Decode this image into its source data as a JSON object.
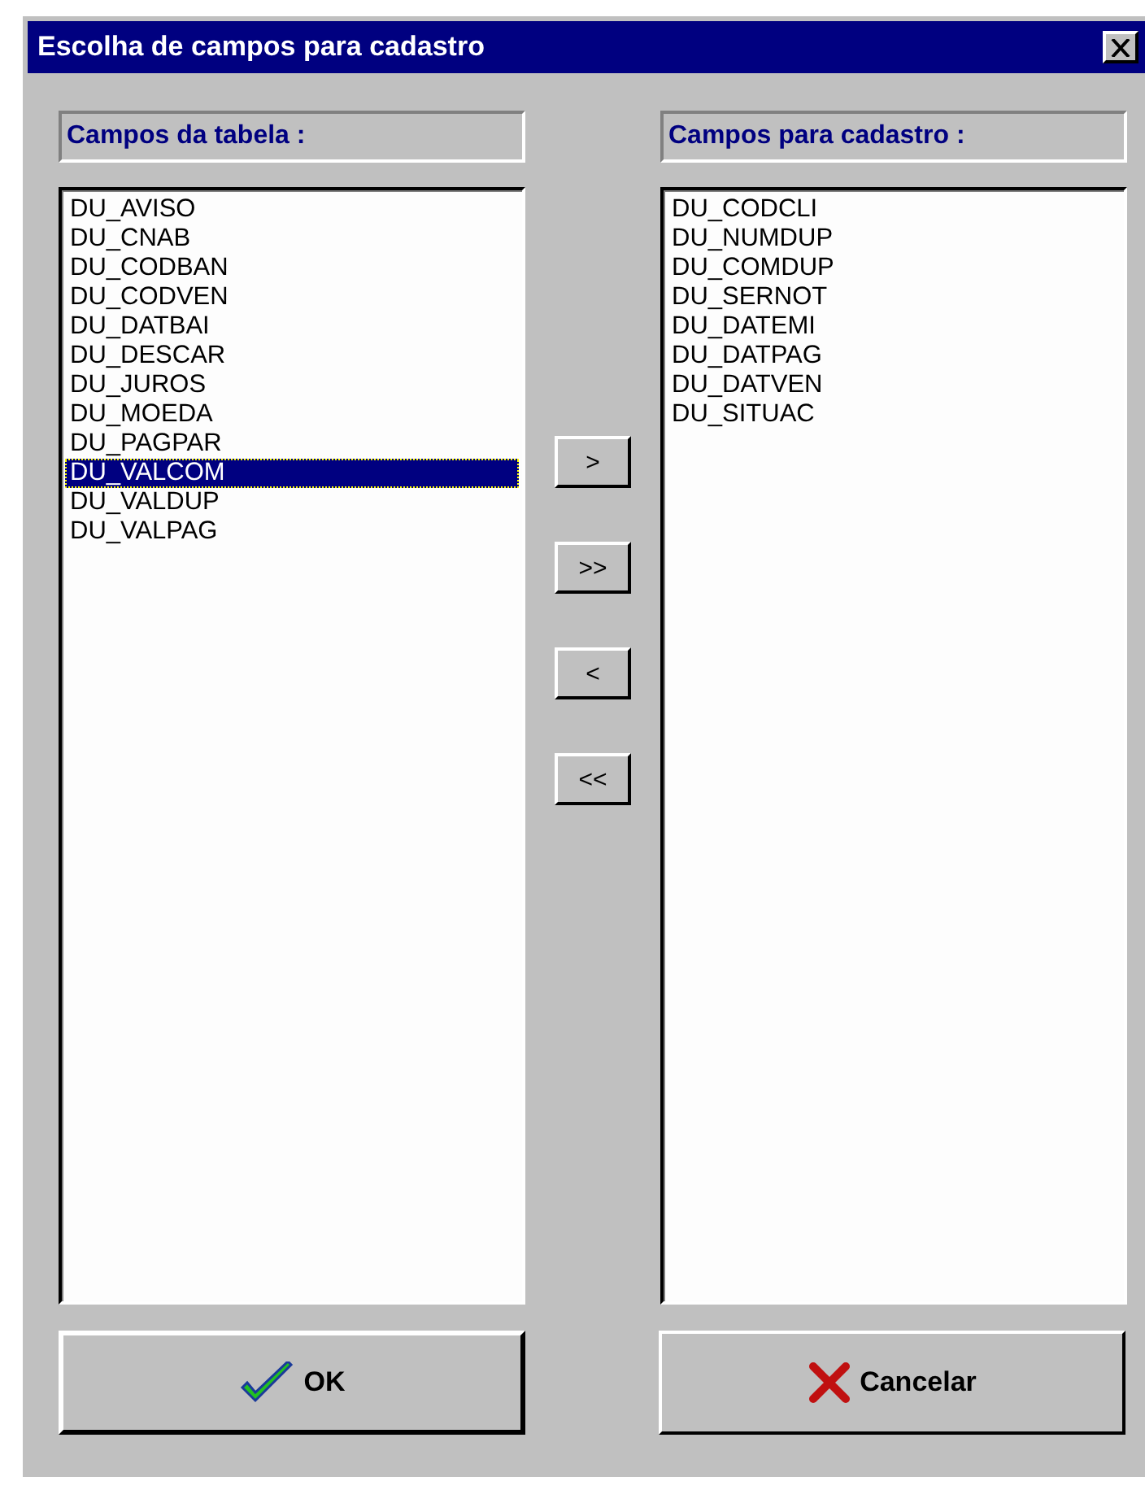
{
  "window": {
    "title": "Escolha de campos para cadastro"
  },
  "source_panel": {
    "label": "Campos da tabela :",
    "items": [
      {
        "text": "DU_AVISO",
        "selected": false
      },
      {
        "text": "DU_CNAB",
        "selected": false
      },
      {
        "text": "DU_CODBAN",
        "selected": false
      },
      {
        "text": "DU_CODVEN",
        "selected": false
      },
      {
        "text": "DU_DATBAI",
        "selected": false
      },
      {
        "text": "DU_DESCAR",
        "selected": false
      },
      {
        "text": "DU_JUROS",
        "selected": false
      },
      {
        "text": "DU_MOEDA",
        "selected": false
      },
      {
        "text": "DU_PAGPAR",
        "selected": false
      },
      {
        "text": "DU_VALCOM",
        "selected": true
      },
      {
        "text": "DU_VALDUP",
        "selected": false
      },
      {
        "text": "DU_VALPAG",
        "selected": false
      }
    ]
  },
  "move_buttons": [
    ">",
    ">>",
    "<",
    "<<"
  ],
  "target_panel": {
    "label": "Campos para cadastro :",
    "items": [
      {
        "text": "DU_CODCLI",
        "selected": false
      },
      {
        "text": "DU_NUMDUP",
        "selected": false
      },
      {
        "text": "DU_COMDUP",
        "selected": false
      },
      {
        "text": "DU_SERNOT",
        "selected": false
      },
      {
        "text": "DU_DATEMI",
        "selected": false
      },
      {
        "text": "DU_DATPAG",
        "selected": false
      },
      {
        "text": "DU_DATVEN",
        "selected": false
      },
      {
        "text": "DU_SITUAC",
        "selected": false
      }
    ]
  },
  "buttons": [
    {
      "label": "OK",
      "kind": "ok"
    },
    {
      "label": "Cancelar",
      "kind": "cancel"
    }
  ]
}
